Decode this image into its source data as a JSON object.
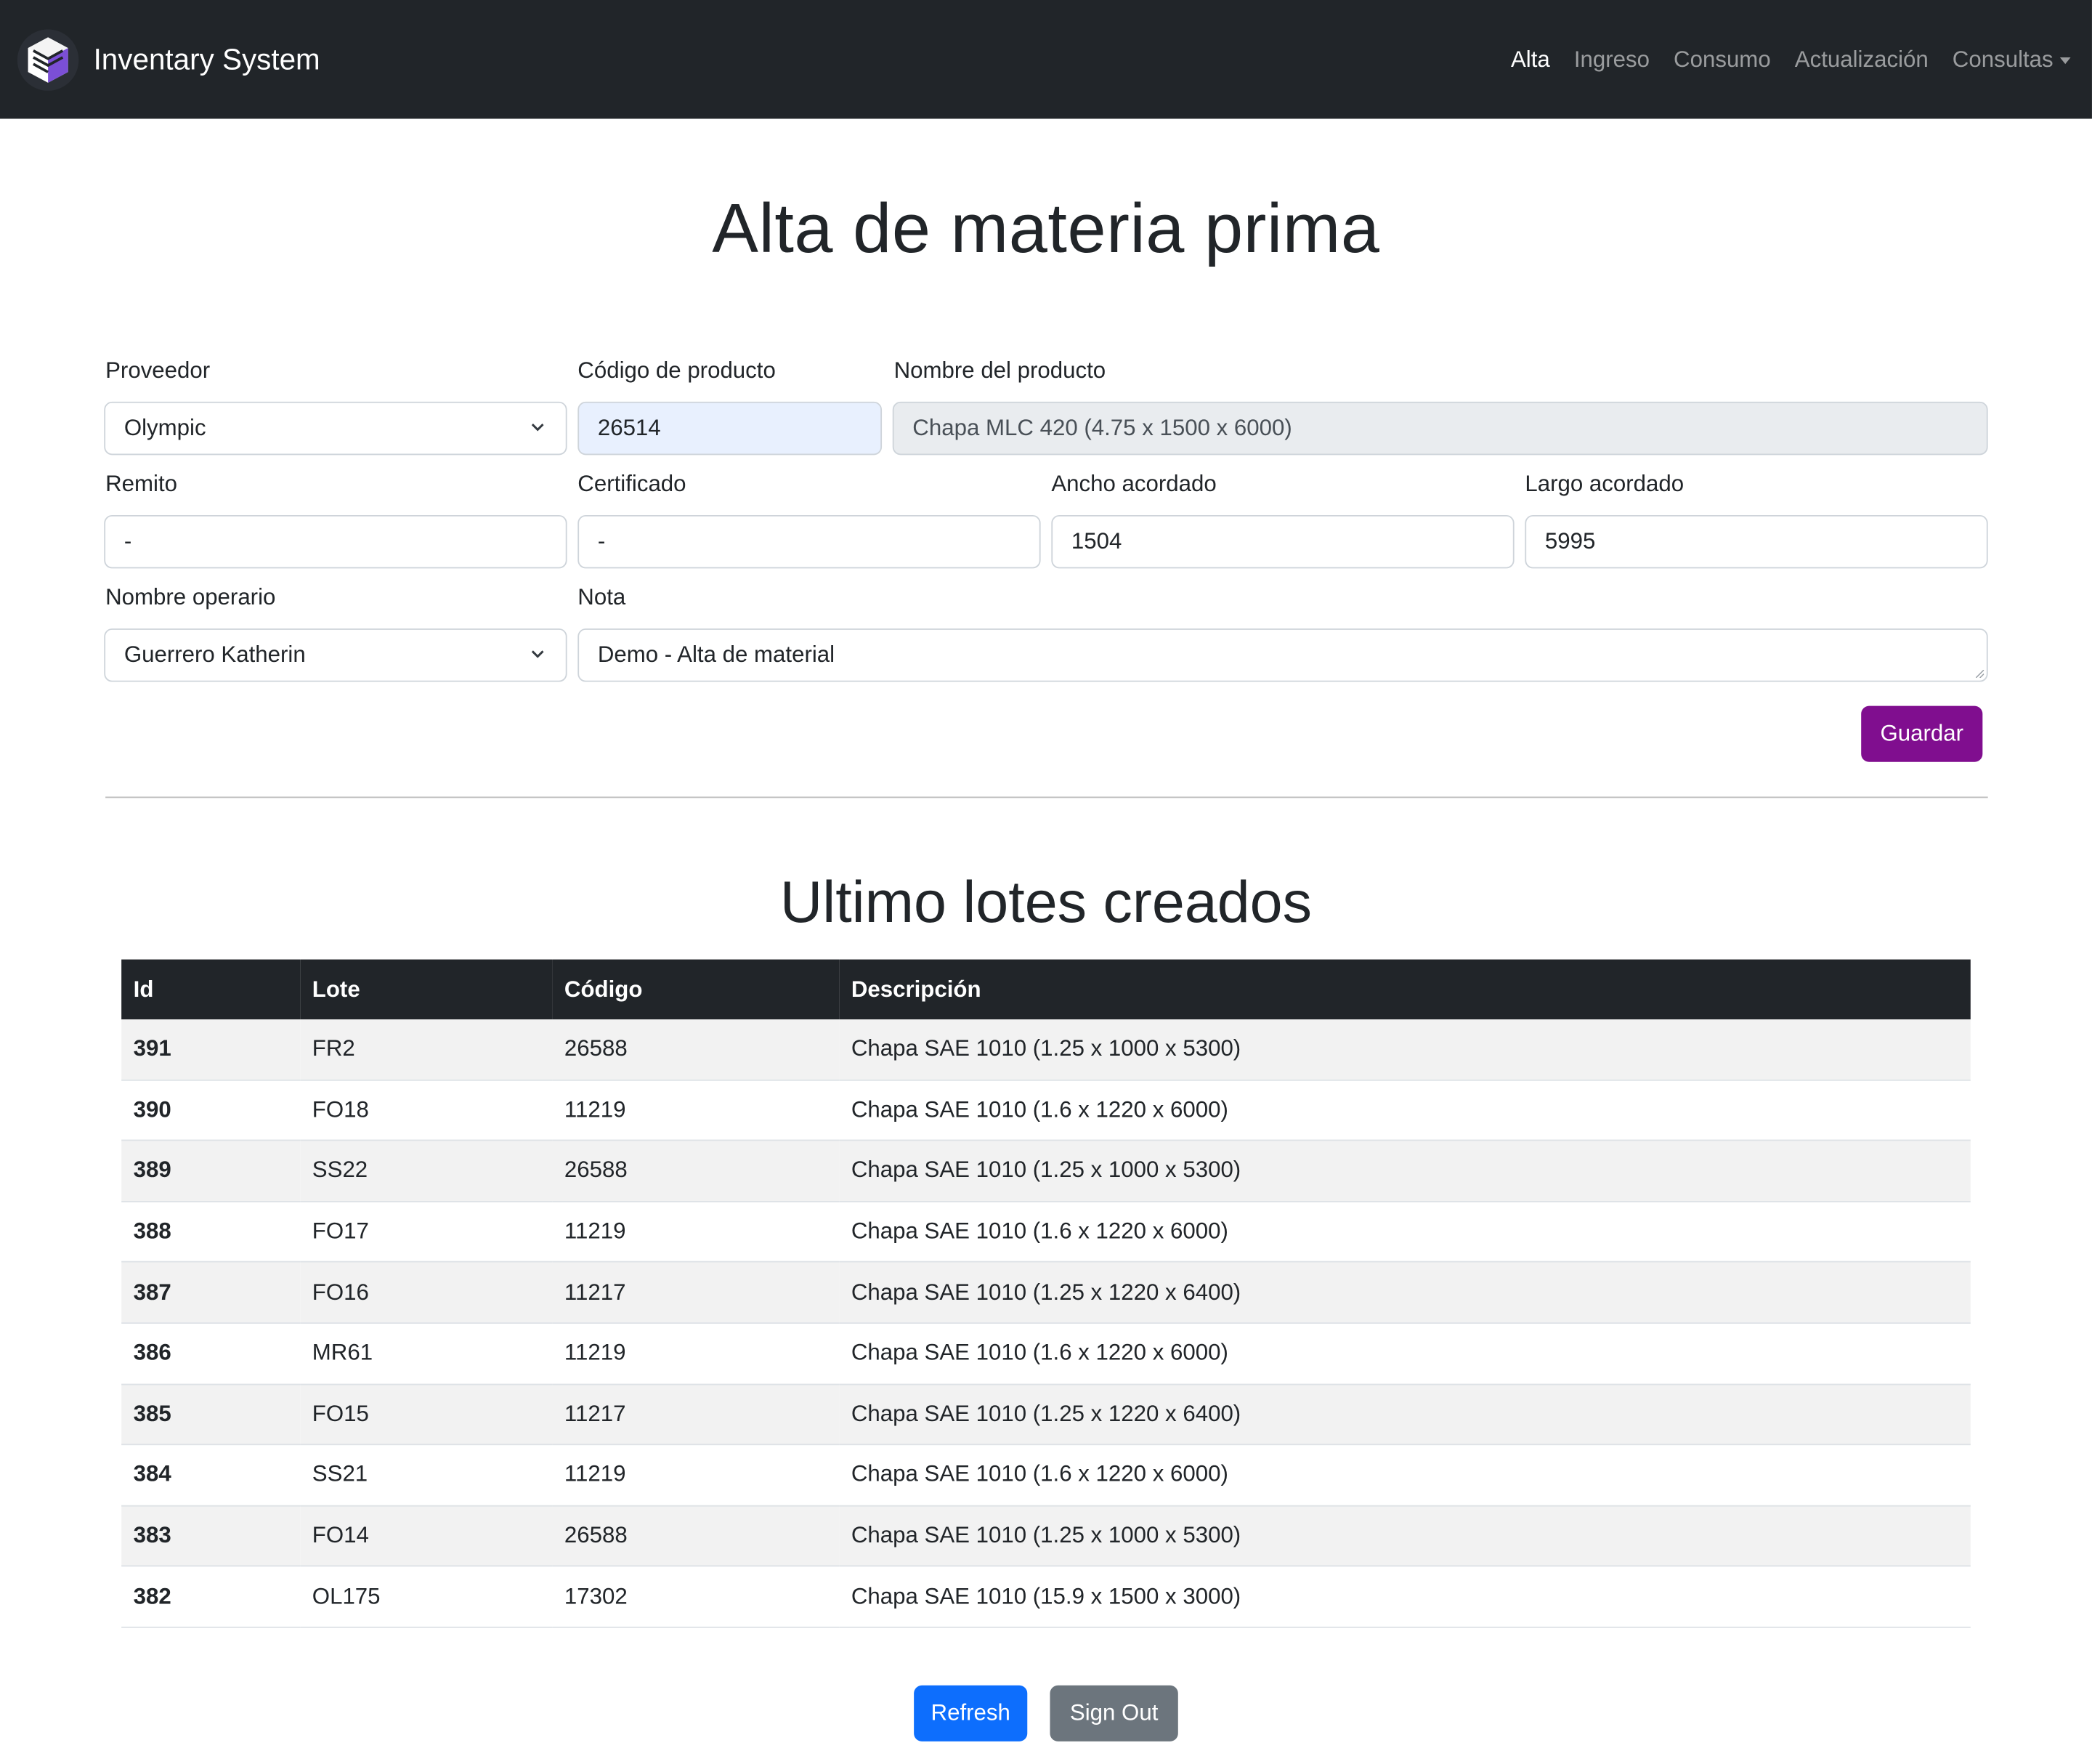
{
  "navbar": {
    "brand": "Inventary System",
    "links": [
      {
        "label": "Alta",
        "active": true
      },
      {
        "label": "Ingreso",
        "active": false
      },
      {
        "label": "Consumo",
        "active": false
      },
      {
        "label": "Actualización",
        "active": false
      },
      {
        "label": "Consultas",
        "active": false,
        "dropdown": true
      }
    ]
  },
  "form": {
    "title": "Alta de materia prima",
    "proveedor": {
      "label": "Proveedor",
      "value": "Olympic"
    },
    "codigo": {
      "label": "Código de producto",
      "value": "26514"
    },
    "nombre": {
      "label": "Nombre del producto",
      "value": "Chapa MLC 420 (4.75 x 1500 x 6000)"
    },
    "remito": {
      "label": "Remito",
      "value": "-"
    },
    "certificado": {
      "label": "Certificado",
      "value": "-"
    },
    "ancho": {
      "label": "Ancho acordado",
      "value": "1504"
    },
    "largo": {
      "label": "Largo acordado",
      "value": "5995"
    },
    "operario": {
      "label": "Nombre operario",
      "value": "Guerrero Katherin"
    },
    "nota": {
      "label": "Nota",
      "value": "Demo - Alta de material"
    },
    "save_label": "Guardar"
  },
  "lotes": {
    "title": "Ultimo lotes creados",
    "headers": [
      "Id",
      "Lote",
      "Código",
      "Descripción"
    ],
    "rows": [
      [
        "391",
        "FR2",
        "26588",
        "Chapa SAE 1010 (1.25 x 1000 x 5300)"
      ],
      [
        "390",
        "FO18",
        "11219",
        "Chapa SAE 1010 (1.6 x 1220 x 6000)"
      ],
      [
        "389",
        "SS22",
        "26588",
        "Chapa SAE 1010 (1.25 x 1000 x 5300)"
      ],
      [
        "388",
        "FO17",
        "11219",
        "Chapa SAE 1010 (1.6 x 1220 x 6000)"
      ],
      [
        "387",
        "FO16",
        "11217",
        "Chapa SAE 1010 (1.25 x 1220 x 6400)"
      ],
      [
        "386",
        "MR61",
        "11219",
        "Chapa SAE 1010 (1.6 x 1220 x 6000)"
      ],
      [
        "385",
        "FO15",
        "11217",
        "Chapa SAE 1010 (1.25 x 1220 x 6400)"
      ],
      [
        "384",
        "SS21",
        "11219",
        "Chapa SAE 1010 (1.6 x 1220 x 6000)"
      ],
      [
        "383",
        "FO14",
        "26588",
        "Chapa SAE 1010 (1.25 x 1000 x 5300)"
      ],
      [
        "382",
        "OL175",
        "17302",
        "Chapa SAE 1010 (15.9 x 1500 x 3000)"
      ]
    ]
  },
  "footer": {
    "refresh_label": "Refresh",
    "signout_label": "Sign Out"
  }
}
